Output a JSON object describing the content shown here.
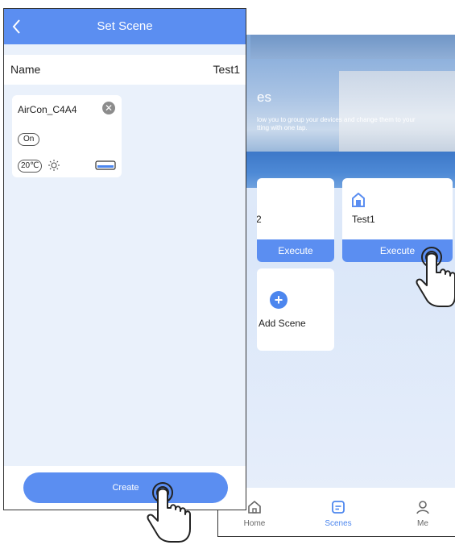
{
  "set_scene": {
    "header_title": "Set Scene",
    "name_label": "Name",
    "name_value": "Test1",
    "device": {
      "name": "AirCon_C4A4",
      "power": "On",
      "temperature": "20℃",
      "mode_icon": "sun-icon",
      "fan_icon": "aircon-unit-icon"
    },
    "create_label": "Create"
  },
  "scenes": {
    "hero_title": "es",
    "hero_desc": "low you to group your devices and change them to your\ntting with one tap.",
    "cards": [
      {
        "name": "2",
        "execute_label": "Execute"
      },
      {
        "name": "Test1",
        "execute_label": "Execute",
        "icon": "home-icon"
      }
    ],
    "add_label": "Add Scene",
    "tabs": [
      {
        "label": "Home",
        "icon": "home-icon"
      },
      {
        "label": "Scenes",
        "icon": "scenes-icon",
        "active": true
      },
      {
        "label": "Me",
        "icon": "person-icon"
      }
    ]
  },
  "colors": {
    "accent": "#5b8ef1",
    "background": "#eaf1fb"
  }
}
